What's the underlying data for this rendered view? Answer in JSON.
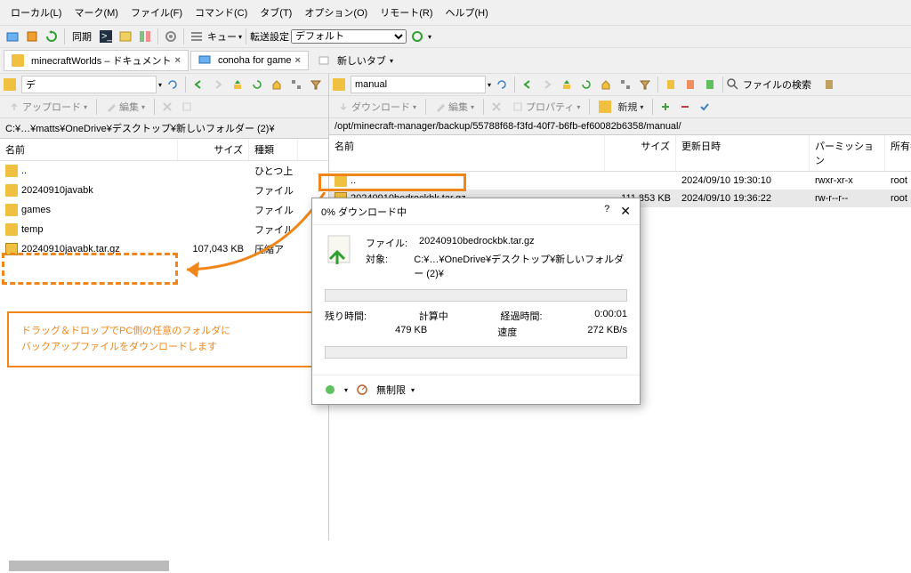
{
  "menu": [
    "ローカル(L)",
    "マーク(M)",
    "ファイル(F)",
    "コマンド(C)",
    "タブ(T)",
    "オプション(O)",
    "リモート(R)",
    "ヘルプ(H)"
  ],
  "sync_label": "同期",
  "queue_label": "キュー",
  "transfer_label": "転送設定",
  "transfer_default": "デフォルト",
  "tabs": [
    {
      "label": "minecraftWorlds – ドキュメント"
    },
    {
      "label": "conoha for game"
    }
  ],
  "newtab": "新しいタブ",
  "left": {
    "nav_value": "デ",
    "upload": "アップロード",
    "edit": "編集",
    "path": "C:¥…¥matts¥OneDrive¥デスクトップ¥新しいフォルダー (2)¥",
    "cols": [
      "名前",
      "サイズ",
      "種類"
    ],
    "rows": [
      {
        "name": "..",
        "size": "",
        "type": "ひとつ上"
      },
      {
        "name": "20240910javabk",
        "size": "",
        "type": "ファイル"
      },
      {
        "name": "games",
        "size": "",
        "type": "ファイル"
      },
      {
        "name": "temp",
        "size": "",
        "type": "ファイル"
      },
      {
        "name": "20240910javabk.tar.gz",
        "size": "107,043 KB",
        "type": "圧縮ア"
      }
    ]
  },
  "right": {
    "nav_value": "manual",
    "download": "ダウンロード",
    "edit": "編集",
    "props": "プロパティ",
    "new": "新規",
    "search": "ファイルの検索",
    "path": "/opt/minecraft-manager/backup/55788f68-f3fd-40f7-b6fb-ef60082b6358/manual/",
    "cols": [
      "名前",
      "サイズ",
      "更新日時",
      "パーミッション",
      "所有者"
    ],
    "rows": [
      {
        "name": "..",
        "size": "",
        "date": "2024/09/10 19:30:10",
        "perm": "rwxr-xr-x",
        "owner": "root"
      },
      {
        "name": "20240910bedrockbk.tar.gz",
        "size": "111,853 KB",
        "date": "2024/09/10 19:36:22",
        "perm": "rw-r--r--",
        "owner": "root"
      }
    ]
  },
  "callout": {
    "l1": "ドラッグ＆ドロップでPC側の任意のフォルダに",
    "l2": "バックアップファイルをダウンロードします"
  },
  "dialog": {
    "title": "0% ダウンロード中",
    "file_lbl": "ファイル:",
    "file_val": "20240910bedrockbk.tar.gz",
    "target_lbl": "対象:",
    "target_val": "C:¥…¥OneDrive¥デスクトップ¥新しいフォルダー (2)¥",
    "remain_lbl": "残り時間:",
    "remain_val": "計算中",
    "elapsed_lbl": "経過時間:",
    "elapsed_val": "0:00:01",
    "bytes": "479 KB",
    "speed_lbl": "速度",
    "speed_val": "272 KB/s",
    "unlimited": "無制限"
  }
}
